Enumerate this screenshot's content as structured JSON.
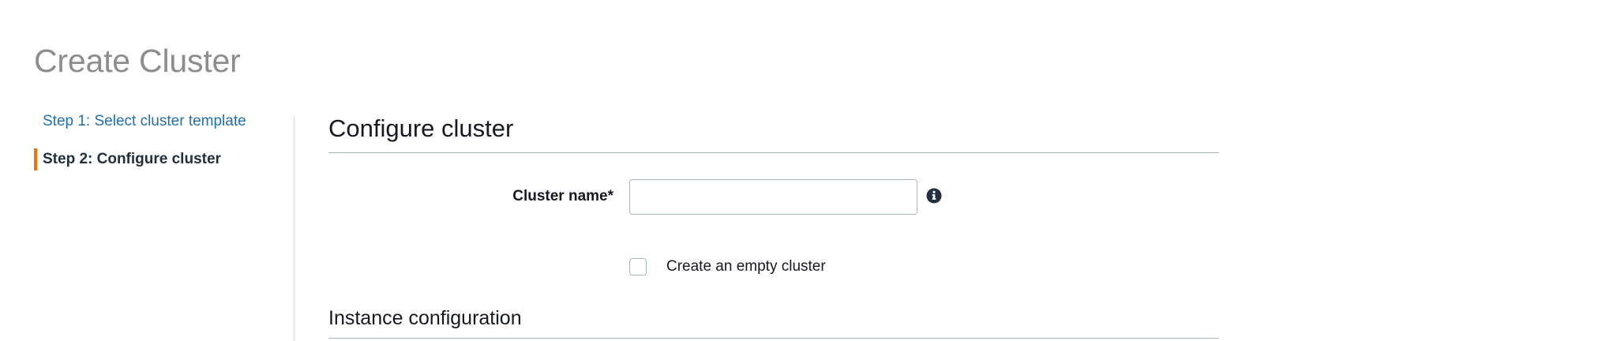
{
  "page": {
    "title": "Create Cluster"
  },
  "wizard": {
    "steps": [
      {
        "label": "Step 1: Select cluster template",
        "state": "link"
      },
      {
        "label": "Step 2: Configure cluster",
        "state": "current"
      }
    ]
  },
  "form": {
    "section_title": "Configure cluster",
    "cluster_name": {
      "label": "Cluster name*",
      "value": "",
      "placeholder": ""
    },
    "info_icon": "info-circle-icon",
    "empty_cluster_checkbox": {
      "label": "Create an empty cluster",
      "checked": false
    },
    "subsection_title": "Instance configuration"
  },
  "colors": {
    "accent_step_marker": "#ec7211",
    "link": "#1f6fb5",
    "title_gray": "#8d8d8d"
  }
}
